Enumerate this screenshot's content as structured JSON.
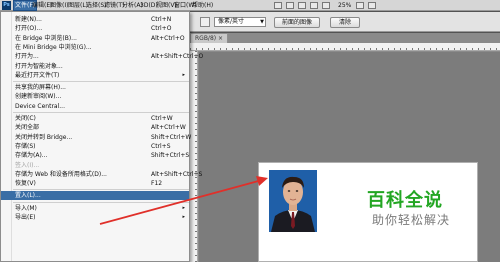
{
  "menubar": {
    "items": [
      {
        "label": "文件(F)",
        "active": true
      },
      {
        "label": "编辑(E)",
        "active": false
      },
      {
        "label": "图像(I)",
        "active": false
      },
      {
        "label": "图层(L)",
        "active": false
      },
      {
        "label": "选择(S)",
        "active": false
      },
      {
        "label": "滤镜(T)",
        "active": false
      },
      {
        "label": "分析(A)",
        "active": false
      },
      {
        "label": "3D(D)",
        "active": false
      },
      {
        "label": "视图(V)",
        "active": false
      },
      {
        "label": "窗口(W)",
        "active": false
      },
      {
        "label": "帮助(H)",
        "active": false
      }
    ],
    "zoom": "25%"
  },
  "options": {
    "resolution_unit": "像素/英寸",
    "front_image_button": "前面的图像",
    "clear_button": "清除"
  },
  "document": {
    "tab_label": "RGB/8) ×"
  },
  "file_menu": {
    "items": [
      {
        "label": "新建(N)...",
        "shortcut": "Ctrl+N"
      },
      {
        "label": "打开(O)...",
        "shortcut": "Ctrl+O"
      },
      {
        "label": "在 Bridge 中浏览(B)...",
        "shortcut": "Alt+Ctrl+O"
      },
      {
        "label": "在 Mini Bridge 中浏览(G)...",
        "shortcut": ""
      },
      {
        "label": "打开为...",
        "shortcut": "Alt+Shift+Ctrl+O"
      },
      {
        "label": "打开为智能对象...",
        "shortcut": ""
      },
      {
        "label": "最近打开文件(T)",
        "shortcut": "",
        "submenu": true
      },
      {
        "sep": true
      },
      {
        "label": "共享我的屏幕(H)...",
        "shortcut": ""
      },
      {
        "label": "创建新审阅(W)...",
        "shortcut": ""
      },
      {
        "label": "Device Central...",
        "shortcut": ""
      },
      {
        "sep": true
      },
      {
        "label": "关闭(C)",
        "shortcut": "Ctrl+W"
      },
      {
        "label": "关闭全部",
        "shortcut": "Alt+Ctrl+W"
      },
      {
        "label": "关闭并转到 Bridge...",
        "shortcut": "Shift+Ctrl+W"
      },
      {
        "label": "存储(S)",
        "shortcut": "Ctrl+S"
      },
      {
        "label": "存储为(A)...",
        "shortcut": "Shift+Ctrl+S"
      },
      {
        "label": "签入(I)...",
        "shortcut": "",
        "disabled": true
      },
      {
        "label": "存储为 Web 和设备所用格式(D)...",
        "shortcut": "Alt+Shift+Ctrl+S"
      },
      {
        "label": "恢复(V)",
        "shortcut": "F12"
      },
      {
        "sep": true
      },
      {
        "label": "置入(L)...",
        "shortcut": "",
        "highlighted": true
      },
      {
        "sep": true
      },
      {
        "label": "导入(M)",
        "shortcut": "",
        "submenu": true
      },
      {
        "label": "导出(E)",
        "shortcut": "",
        "submenu": true
      }
    ],
    "submenu_glyph": "▸"
  },
  "canvas": {
    "brand_title": "百科全说",
    "brand_subtitle": "助你轻松解决"
  },
  "colors": {
    "menu_highlight": "#3a6ea5",
    "brand_green": "#23a623",
    "annotation_arrow": "#e0302a",
    "photo_background": "#1f5fa8"
  }
}
